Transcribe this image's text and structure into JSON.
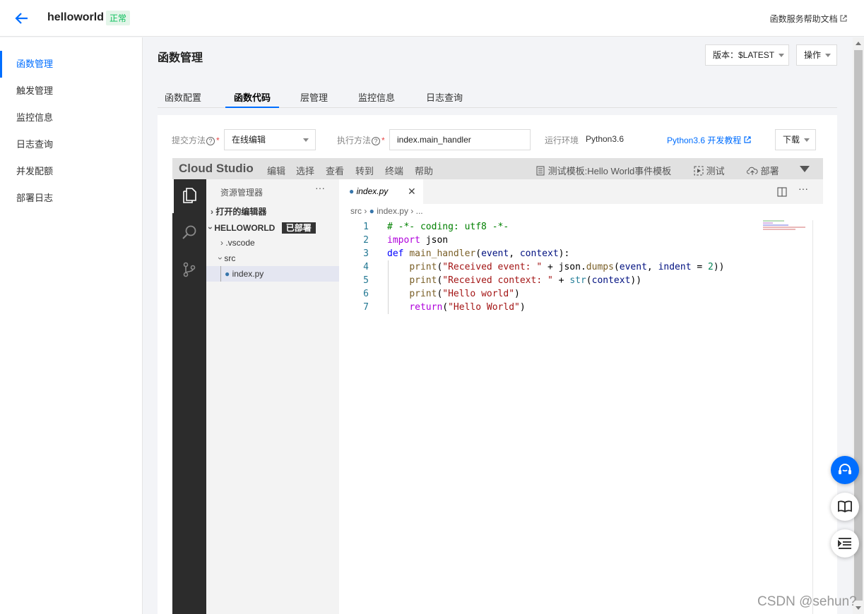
{
  "header": {
    "function_name": "helloworld",
    "status": "正常",
    "help_link": "函数服务帮助文档"
  },
  "sidebar": {
    "items": [
      {
        "label": "函数管理",
        "active": true
      },
      {
        "label": "触发管理"
      },
      {
        "label": "监控信息"
      },
      {
        "label": "日志查询"
      },
      {
        "label": "并发配额"
      },
      {
        "label": "部署日志"
      }
    ]
  },
  "main": {
    "title": "函数管理",
    "version_select": "版本：$LATEST",
    "ops_button": "操作",
    "tabs": [
      {
        "label": "函数配置"
      },
      {
        "label": "函数代码",
        "active": true
      },
      {
        "label": "层管理"
      },
      {
        "label": "监控信息"
      },
      {
        "label": "日志查询"
      }
    ],
    "form": {
      "submit_method_label": "提交方法",
      "submit_method_value": "在线编辑",
      "handler_label": "执行方法",
      "handler_value": "index.main_handler",
      "runtime_label": "运行环境",
      "runtime_value": "Python3.6",
      "tutorial_link": "Python3.6 开发教程",
      "download_button": "下载"
    }
  },
  "ide": {
    "brand": "Cloud Studio",
    "menu": [
      "编辑",
      "选择",
      "查看",
      "转到",
      "终端",
      "帮助"
    ],
    "test_template": "测试模板:Hello World事件模板",
    "test_button": "测试",
    "deploy_button": "部署",
    "explorer": {
      "title": "资源管理器",
      "open_editors": "打开的编辑器",
      "project": "HELLOWORLD",
      "deployed_badge": "已部署",
      "tree": [
        ".vscode",
        "src",
        "index.py"
      ]
    },
    "editor_tab": "index.py",
    "breadcrumb": {
      "folder": "src",
      "file": "index.py",
      "more": "..."
    },
    "code_lines": [
      {
        "n": "1"
      },
      {
        "n": "2"
      },
      {
        "n": "3"
      },
      {
        "n": "4"
      },
      {
        "n": "5"
      },
      {
        "n": "6"
      },
      {
        "n": "7"
      }
    ]
  },
  "watermark": "CSDN @sehun?",
  "colors": {
    "accent": "#006eff",
    "status_green": "#0abf5b",
    "activity_bg": "#2c2c2c"
  }
}
